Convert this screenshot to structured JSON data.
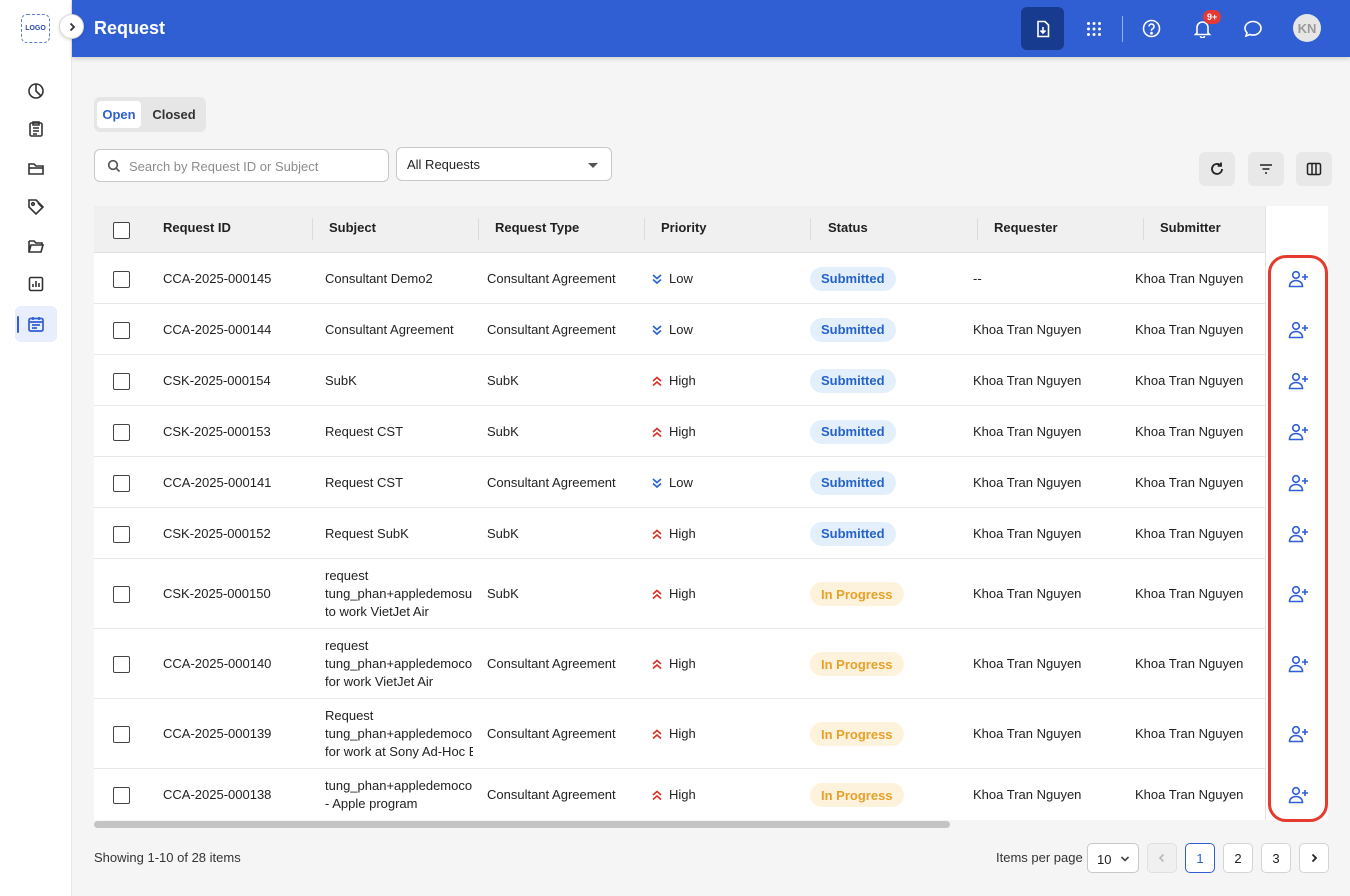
{
  "app": {
    "logo_text": "LOGO",
    "page_title": "Request",
    "accent_color": "#2f5fd3"
  },
  "header": {
    "notification_count": "9+",
    "avatar_initials": "KN"
  },
  "tabs": [
    {
      "label": "Open",
      "active": true
    },
    {
      "label": "Closed",
      "active": false
    }
  ],
  "toolbar": {
    "search_placeholder": "Search by Request ID or Subject",
    "filter_selected": "All Requests"
  },
  "table": {
    "columns": [
      "Request ID",
      "Subject",
      "Request Type",
      "Priority",
      "Status",
      "Requester",
      "Submitter"
    ],
    "rows": [
      {
        "id": "CCA-2025-000145",
        "subject": [
          "Consultant Demo2"
        ],
        "type": "Consultant Agreement",
        "priority": "Low",
        "status": "Submitted",
        "requester": "--",
        "submitter": "Khoa Tran Nguyen"
      },
      {
        "id": "CCA-2025-000144",
        "subject": [
          "Consultant Agreement"
        ],
        "type": "Consultant Agreement",
        "priority": "Low",
        "status": "Submitted",
        "requester": "Khoa Tran Nguyen",
        "submitter": "Khoa Tran Nguyen"
      },
      {
        "id": "CSK-2025-000154",
        "subject": [
          "SubK"
        ],
        "type": "SubK",
        "priority": "High",
        "status": "Submitted",
        "requester": "Khoa Tran Nguyen",
        "submitter": "Khoa Tran Nguyen"
      },
      {
        "id": "CSK-2025-000153",
        "subject": [
          "Request CST"
        ],
        "type": "SubK",
        "priority": "High",
        "status": "Submitted",
        "requester": "Khoa Tran Nguyen",
        "submitter": "Khoa Tran Nguyen"
      },
      {
        "id": "CCA-2025-000141",
        "subject": [
          "Request CST"
        ],
        "type": "Consultant Agreement",
        "priority": "Low",
        "status": "Submitted",
        "requester": "Khoa Tran Nguyen",
        "submitter": "Khoa Tran Nguyen"
      },
      {
        "id": "CSK-2025-000152",
        "subject": [
          "Request SubK"
        ],
        "type": "SubK",
        "priority": "High",
        "status": "Submitted",
        "requester": "Khoa Tran Nguyen",
        "submitter": "Khoa Tran Nguyen"
      },
      {
        "id": "CSK-2025-000150",
        "subject": [
          "request",
          "tung_phan+appledemosub",
          "to work VietJet Air"
        ],
        "type": "SubK",
        "priority": "High",
        "status": "In Progress",
        "requester": "Khoa Tran Nguyen",
        "submitter": "Khoa Tran Nguyen"
      },
      {
        "id": "CCA-2025-000140",
        "subject": [
          "request",
          "tung_phan+appledemocon",
          "for work VietJet Air"
        ],
        "type": "Consultant Agreement",
        "priority": "High",
        "status": "In Progress",
        "requester": "Khoa Tran Nguyen",
        "submitter": "Khoa Tran Nguyen"
      },
      {
        "id": "CCA-2025-000139",
        "subject": [
          "Request",
          "tung_phan+appledemocon",
          "for work at Sony Ad-Hoc Ex"
        ],
        "type": "Consultant Agreement",
        "priority": "High",
        "status": "In Progress",
        "requester": "Khoa Tran Nguyen",
        "submitter": "Khoa Tran Nguyen"
      },
      {
        "id": "CCA-2025-000138",
        "subject": [
          "tung_phan+appledemocon",
          "- Apple program"
        ],
        "type": "Consultant Agreement",
        "priority": "High",
        "status": "In Progress",
        "requester": "Khoa Tran Nguyen",
        "submitter": "Khoa Tran Nguyen"
      }
    ]
  },
  "footer": {
    "showing_text": "Showing 1-10 of 28 items",
    "items_per_page_label": "Items per page",
    "items_per_page_value": "10",
    "pages": [
      "1",
      "2",
      "3"
    ],
    "current_page": "1"
  },
  "icons": {
    "sidebar": [
      "dashboard-icon",
      "clipboard-icon",
      "folder-icon",
      "tag-icon",
      "folder-open-icon",
      "report-icon",
      "calendar-icon"
    ],
    "header": [
      "download-icon",
      "apps-grid-icon",
      "help-icon",
      "bell-icon",
      "chat-icon"
    ],
    "row_action": "add-user-icon"
  },
  "colors": {
    "submitted_bg": "#e3effb",
    "submitted_text": "#2563c9",
    "in_progress_bg": "#fdf3dc",
    "in_progress_text": "#e7a02a",
    "priority_low": "#2563c9",
    "priority_high": "#d93025",
    "highlight": "#e53a2e"
  }
}
